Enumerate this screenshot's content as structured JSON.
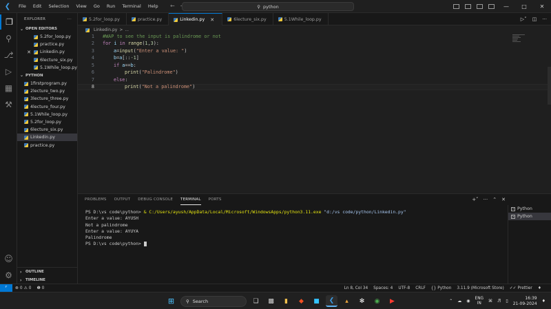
{
  "menu": [
    "File",
    "Edit",
    "Selection",
    "View",
    "Go",
    "Run",
    "Terminal",
    "Help"
  ],
  "command_center": {
    "text": "python"
  },
  "sidebar": {
    "title": "EXPLORER",
    "open_editors_title": "OPEN EDITORS",
    "open_editors": [
      "5.2for_loop.py",
      "practice.py",
      "Linkedin.py",
      "6lecture_six.py",
      "5.1While_loop.py"
    ],
    "folder_title": "PYTHON",
    "files": [
      "1firstprogram.py",
      "2lecture_two.py",
      "3lecture_three.py",
      "4lecture_four.py",
      "5.1While_loop.py",
      "5.2for_loop.py",
      "6lecture_six.py",
      "Linkedin.py",
      "practice.py"
    ],
    "outline_title": "OUTLINE",
    "timeline_title": "TIMELINE"
  },
  "tabs": [
    "5.2for_loop.py",
    "practice.py",
    "Linkedin.py",
    "6lecture_six.py",
    "5.1While_loop.py"
  ],
  "breadcrumb": {
    "file": "Linkedin.py",
    "sep": ">",
    "more": "..."
  },
  "code": {
    "line_numbers": [
      "1",
      "2",
      "3",
      "4",
      "5",
      "6",
      "7",
      "8"
    ],
    "l1": "#WAP to see the input is palindrome or not",
    "l2_for": "for",
    "l2_i": " i ",
    "l2_in": "in",
    "l2_range": " range",
    "l2_open": "(",
    "l2_n1": "1",
    "l2_comma": ",",
    "l2_n2": "3",
    "l2_close": "):",
    "l3_a": "a",
    "l3_eq": "=",
    "l3_input": "input",
    "l3_open": "(",
    "l3_str": "\"Enter a value: \"",
    "l3_close": ")",
    "l4_b": "b",
    "l4_eq": "=",
    "l4_a": "a",
    "l4_slice_open": "[::",
    "l4_num": "-1",
    "l4_slice_close": "]",
    "l5_if": "if",
    "l5_a": " a",
    "l5_eq": "==",
    "l5_b": "b",
    "l5_colon": ":",
    "l6_print": "print",
    "l6_open": "(",
    "l6_str": "\"Palindrome\"",
    "l6_close": ")",
    "l7_else": "else",
    "l7_colon": ":",
    "l8_print": "print",
    "l8_open": "(",
    "l8_str": "\"Not a palindrome\"",
    "l8_close": ")"
  },
  "panel": {
    "tabs": [
      "PROBLEMS",
      "OUTPUT",
      "DEBUG CONSOLE",
      "TERMINAL",
      "PORTS"
    ],
    "terminal_prompt": "PS D:\\vs code\\python> ",
    "command_amp": "& ",
    "command_exe": "C:/Users/ayush/AppData/Local/Microsoft/WindowsApps/python3.11.exe",
    "command_arg": " \"d:/vs code/python/Linkedin.py\"",
    "output": [
      "Enter a value: AYUSH",
      "Not a palindrome",
      "Enter a value: AYUYA",
      "Palindrome"
    ],
    "terminals": [
      "Python",
      "Python"
    ]
  },
  "status": {
    "errors": "0",
    "warnings": "0",
    "ports": "0",
    "position": "Ln 8, Col 34",
    "spaces": "Spaces: 4",
    "encoding": "UTF-8",
    "eol": "CRLF",
    "language": "Python",
    "interpreter": "3.11.9 (Microsoft Store)",
    "prettier": "Prettier"
  },
  "taskbar": {
    "search_label": "Search",
    "lang_line1": "ENG",
    "lang_line2": "IN",
    "time": "16:39",
    "date": "21-09-2024"
  }
}
